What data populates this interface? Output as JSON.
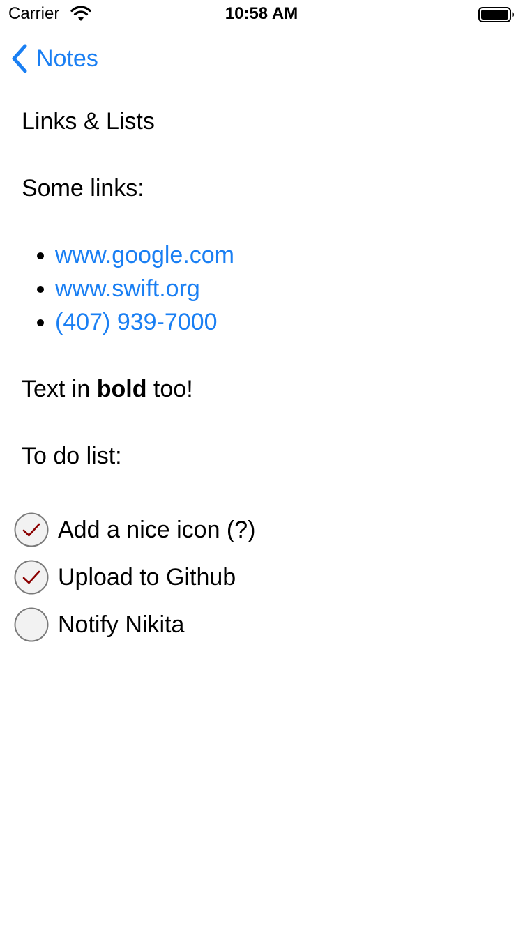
{
  "status_bar": {
    "carrier": "Carrier",
    "time": "10:58 AM",
    "icons": [
      "wifi-icon",
      "battery-icon"
    ]
  },
  "nav": {
    "back_label": "Notes",
    "back_icon": "chevron-left-icon"
  },
  "note": {
    "title": "Links & Lists",
    "links_heading": "Some links:",
    "links": [
      {
        "text": "www.google.com"
      },
      {
        "text": "www.swift.org"
      },
      {
        "text": "(407) 939-7000"
      }
    ],
    "bold_line": {
      "before": "Text in ",
      "bold": "bold",
      "after": " too!"
    },
    "todo_heading": "To do list:",
    "todos": [
      {
        "label": "Add a nice icon (?)",
        "checked": true
      },
      {
        "label": "Upload to Github",
        "checked": true
      },
      {
        "label": "Notify Nikita",
        "checked": false
      }
    ]
  },
  "colors": {
    "accent": "#1a7ff3",
    "checkmark": "#8b0000",
    "circle_border": "#7a7a7a",
    "circle_fill": "#f2f2f2"
  }
}
